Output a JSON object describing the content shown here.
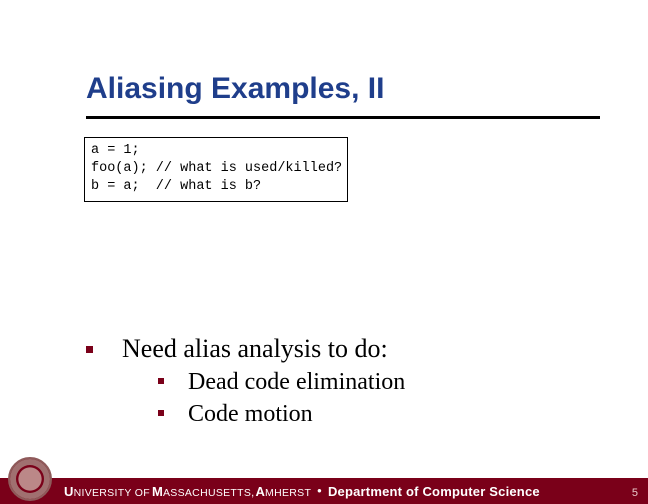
{
  "title": "Aliasing Examples, II",
  "code": "a = 1;\nfoo(a); // what is used/killed?\nb = a;  // what is b?",
  "body": {
    "intro": "Need alias analysis to do:",
    "items": [
      "Dead code elimination",
      "Code motion"
    ]
  },
  "footer": {
    "u_first": "U",
    "u_rest": "NIVERSITY OF ",
    "m_first": "M",
    "m_rest": "ASSACHUSETTS",
    "comma": ", ",
    "a_first": "A",
    "a_rest": "MHERST",
    "separator": "•",
    "dept": "Department of Computer Science",
    "page": "5"
  }
}
